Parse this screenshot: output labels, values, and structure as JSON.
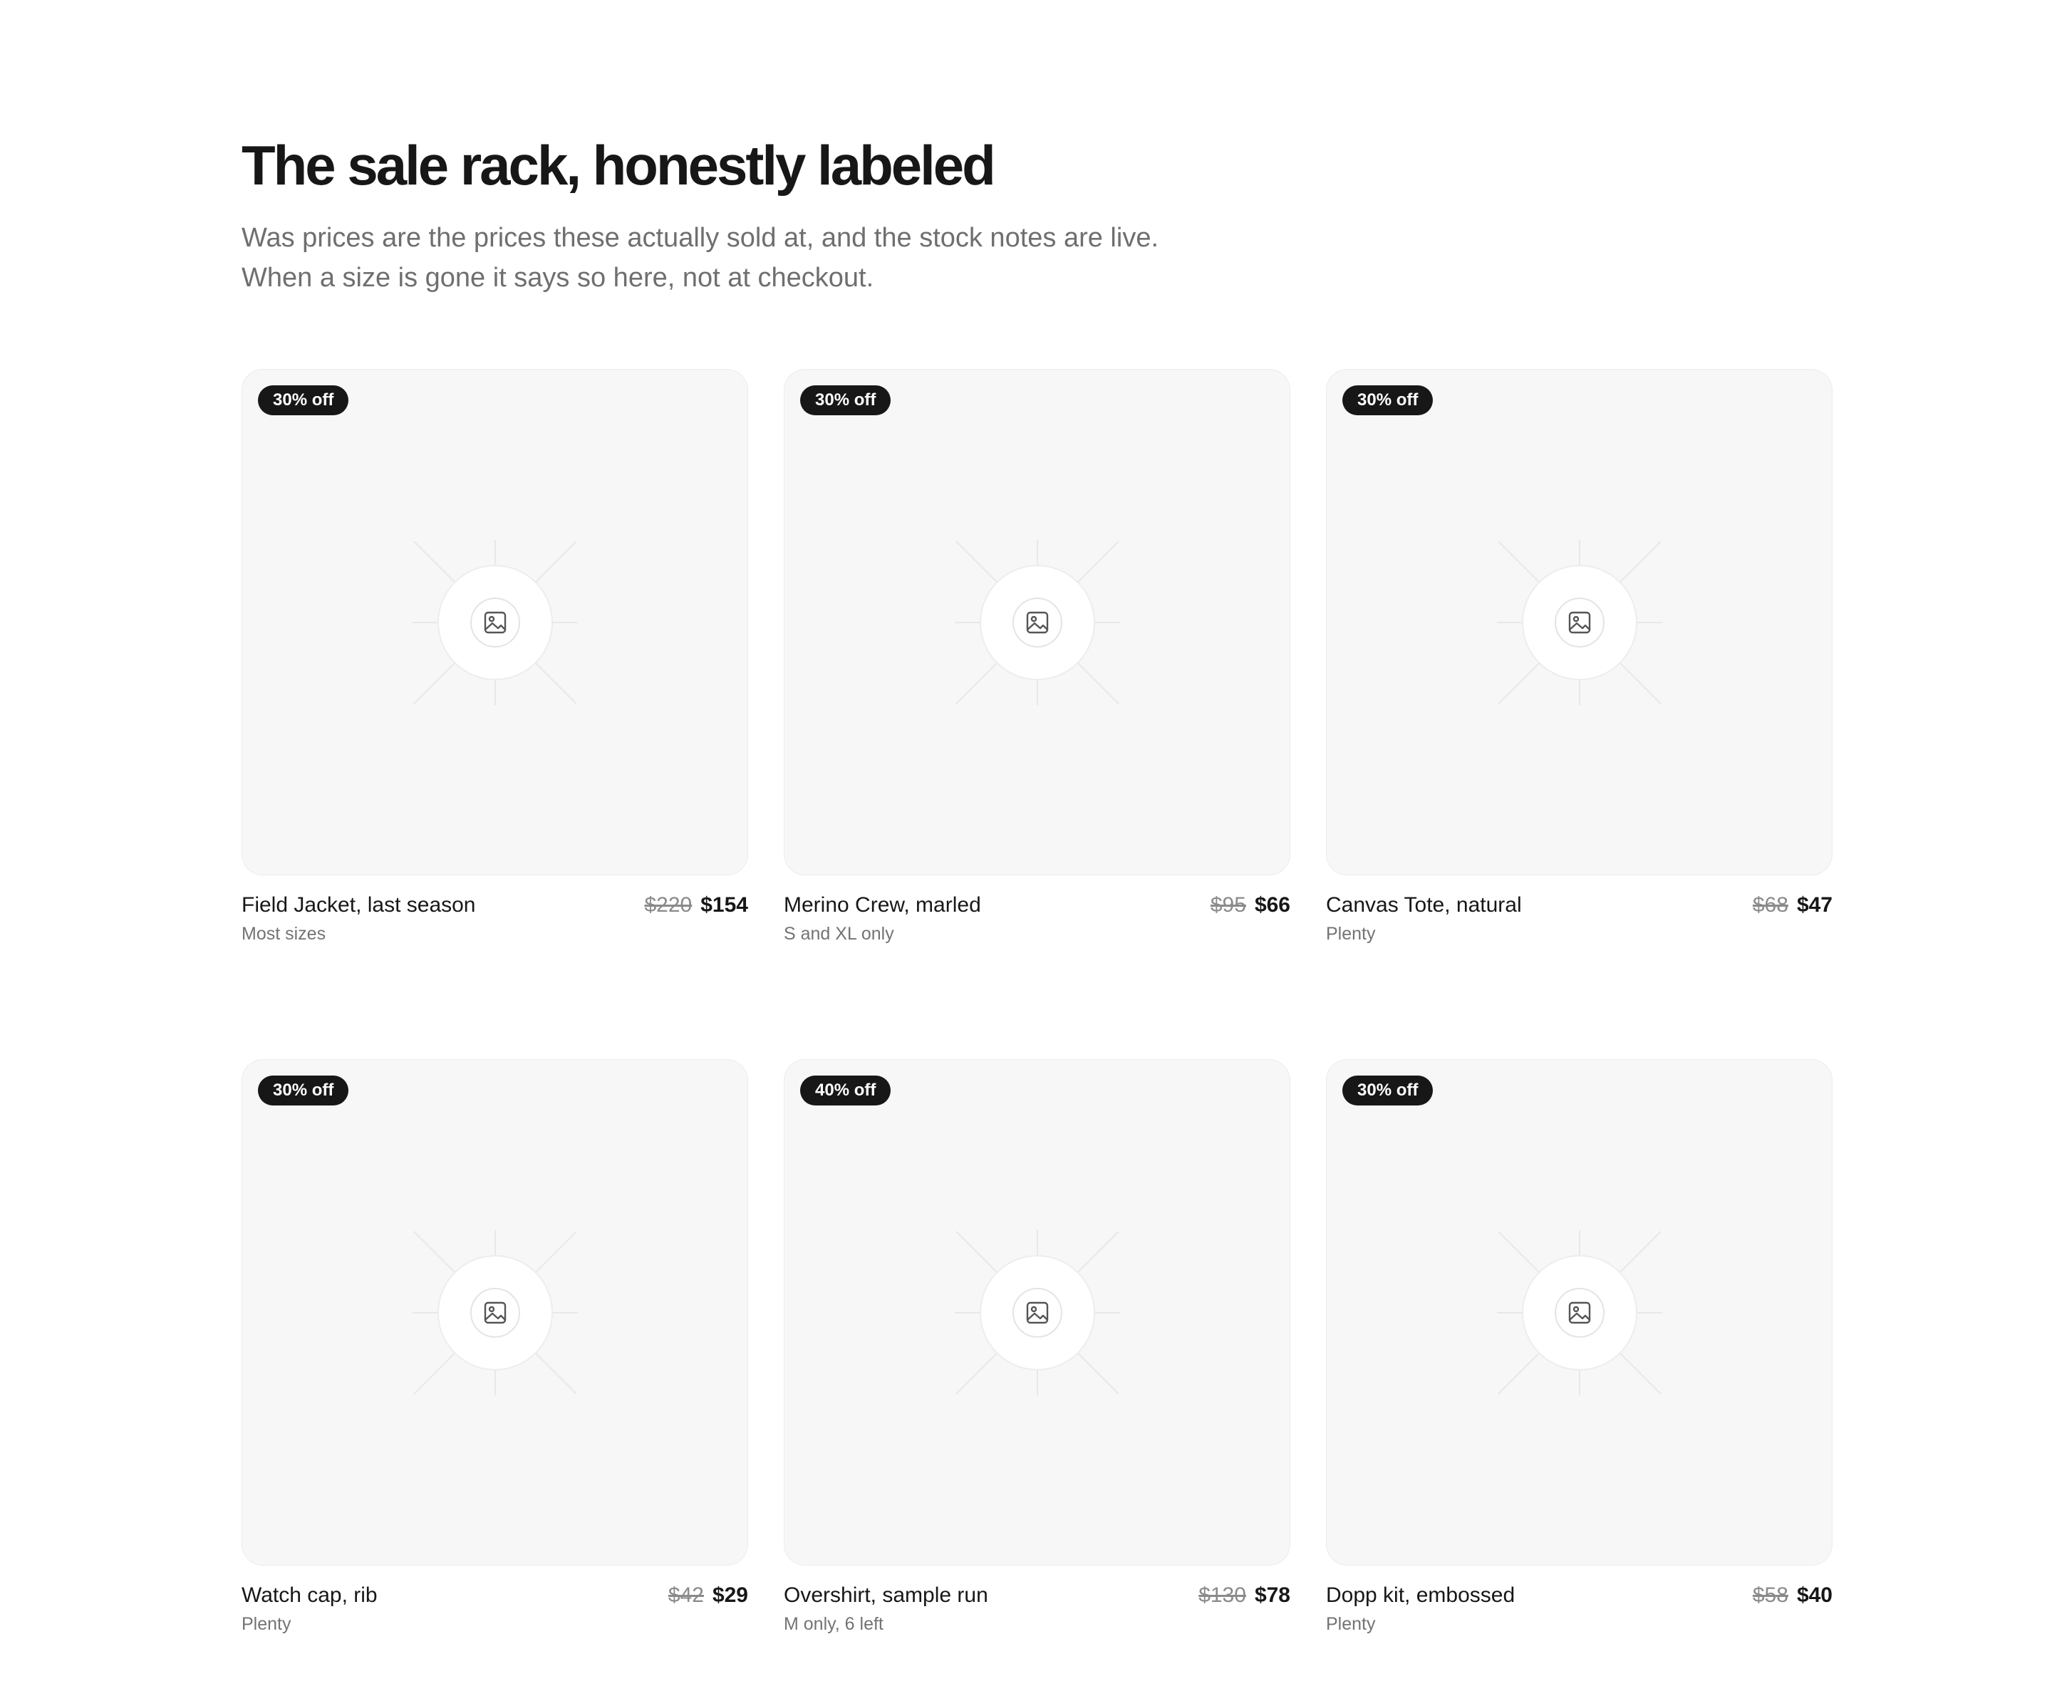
{
  "header": {
    "title": "The sale rack, honestly labeled",
    "subtitle_line1": "Was prices are the prices these actually sold at, and the stock notes are live.",
    "subtitle_line2": "When a size is gone it says so here, not at checkout."
  },
  "products": [
    {
      "badge": "30% off",
      "name": "Field Jacket, last season",
      "was_price": "$220",
      "price": "$154",
      "stock": "Most sizes",
      "icon": "image-placeholder-icon"
    },
    {
      "badge": "30% off",
      "name": "Merino Crew, marled",
      "was_price": "$95",
      "price": "$66",
      "stock": "S and XL only",
      "icon": "image-placeholder-icon"
    },
    {
      "badge": "30% off",
      "name": "Canvas Tote, natural",
      "was_price": "$68",
      "price": "$47",
      "stock": "Plenty",
      "icon": "image-placeholder-icon"
    },
    {
      "badge": "30% off",
      "name": "Watch cap, rib",
      "was_price": "$42",
      "price": "$29",
      "stock": "Plenty",
      "icon": "image-placeholder-icon"
    },
    {
      "badge": "40% off",
      "name": "Overshirt, sample run",
      "was_price": "$130",
      "price": "$78",
      "stock": "M only, 6 left",
      "icon": "image-placeholder-icon"
    },
    {
      "badge": "30% off",
      "name": "Dopp kit, embossed",
      "was_price": "$58",
      "price": "$40",
      "stock": "Plenty",
      "icon": "image-placeholder-icon"
    }
  ],
  "colors": {
    "text": "#171717",
    "muted": "#6f6f6f",
    "badge_bg": "#171717",
    "card_bg": "#f7f7f7"
  }
}
